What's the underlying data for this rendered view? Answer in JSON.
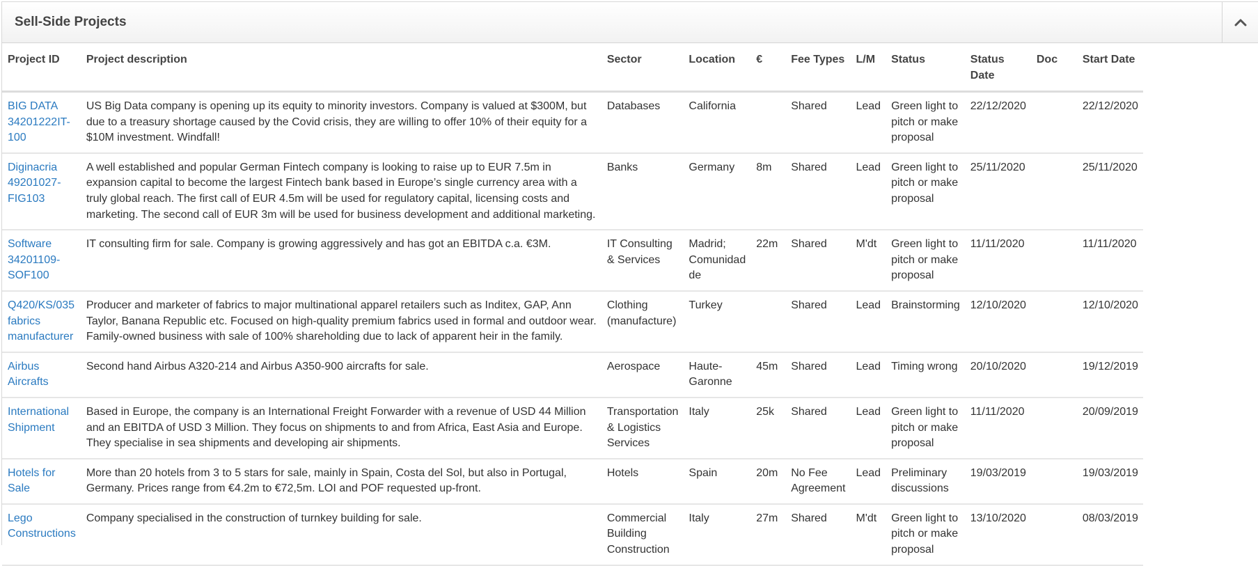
{
  "panel": {
    "title": "Sell-Side Projects",
    "collapse_icon": "chevron-up-icon"
  },
  "columns": [
    "Project ID",
    "Project description",
    "Sector",
    "Location",
    "€",
    "Fee Types",
    "L/M",
    "Status",
    "Status Date",
    "Doc",
    "Start Date"
  ],
  "rows": [
    {
      "project_id": "BIG DATA 34201222IT-100",
      "description": "US Big Data company is opening up its equity to minority investors. Company is valued at $300M, but due to a treasury shortage caused by the Covid crisis, they are willing to offer 10% of their equity for a $10M investment. Windfall!",
      "sector": "Databases",
      "location": "California",
      "amount": "",
      "fee_types": "Shared",
      "lm": "Lead",
      "status": "Green light to pitch or make proposal",
      "status_date": "22/12/2020",
      "doc": "",
      "start_date": "22/12/2020"
    },
    {
      "project_id": "Diginacria 49201027-FIG103",
      "description": "A well established and popular German Fintech company is looking to raise up to EUR 7.5m in expansion capital to become the largest Fintech bank based in Europe’s single currency area with a truly global reach. The first call of EUR 4.5m will be used for regulatory capital, licensing costs and marketing. The second call of EUR 3m will be used for business development and additional marketing.",
      "sector": "Banks",
      "location": "Germany",
      "amount": "8m",
      "fee_types": "Shared",
      "lm": "Lead",
      "status": "Green light to pitch or make proposal",
      "status_date": "25/11/2020",
      "doc": "",
      "start_date": "25/11/2020"
    },
    {
      "project_id": "Software 34201109-SOF100",
      "description": "IT consulting firm for sale. Company is growing aggressively and has got an EBITDA c.a. €3M.",
      "sector": "IT Consulting & Services",
      "location": "Madrid; Comunidad de",
      "amount": "22m",
      "fee_types": "Shared",
      "lm": "M'dt",
      "status": "Green light to pitch or make proposal",
      "status_date": "11/11/2020",
      "doc": "",
      "start_date": "11/11/2020"
    },
    {
      "project_id": "Q420/KS/035 fabrics manufacturer",
      "description": "Producer and marketer of fabrics to major multinational apparel retailers such as Inditex, GAP, Ann Taylor, Banana Republic etc. Focused on high-quality premium fabrics used in formal and outdoor wear. Family-owned business with sale of 100% shareholding due to lack of apparent heir in the family.",
      "sector": "Clothing (manufacture)",
      "location": "Turkey",
      "amount": "",
      "fee_types": "Shared",
      "lm": "Lead",
      "status": "Brainstorming",
      "status_date": "12/10/2020",
      "doc": "",
      "start_date": "12/10/2020"
    },
    {
      "project_id": "Airbus Aircrafts",
      "description": "Second hand Airbus A320-214 and Airbus A350-900 aircrafts for sale.",
      "sector": "Aerospace",
      "location": "Haute-Garonne",
      "amount": "45m",
      "fee_types": "Shared",
      "lm": "Lead",
      "status": "Timing wrong",
      "status_date": "20/10/2020",
      "doc": "",
      "start_date": "19/12/2019"
    },
    {
      "project_id": "International Shipment",
      "description": "Based in Europe, the company is an International Freight Forwarder with a revenue of USD 44 Million and an EBITDA of USD 3 Million. They focus on shipments to and from Africa, East Asia and Europe. They specialise in sea shipments and developing air shipments.",
      "sector": "Transportation & Logistics Services",
      "location": "Italy",
      "amount": "25k",
      "fee_types": "Shared",
      "lm": "Lead",
      "status": "Green light to pitch or make proposal",
      "status_date": "11/11/2020",
      "doc": "",
      "start_date": "20/09/2019"
    },
    {
      "project_id": "Hotels for Sale",
      "description": "More than 20 hotels from 3 to 5 stars for sale, mainly in Spain, Costa del Sol, but also in Portugal, Germany. Prices range from €4.2m to €72,5m. LOI and POF requested up-front.",
      "sector": "Hotels",
      "location": "Spain",
      "amount": "20m",
      "fee_types": "No Fee Agreement",
      "lm": "Lead",
      "status": "Preliminary discussions",
      "status_date": "19/03/2019",
      "doc": "",
      "start_date": "19/03/2019"
    },
    {
      "project_id": "Lego Constructions",
      "description": "Company specialised in the construction of turnkey building for sale.",
      "sector": "Commercial Building Construction",
      "location": "Italy",
      "amount": "27m",
      "fee_types": "Shared",
      "lm": "M'dt",
      "status": "Green light to pitch or make proposal",
      "status_date": "13/10/2020",
      "doc": "",
      "start_date": "08/03/2019"
    }
  ]
}
